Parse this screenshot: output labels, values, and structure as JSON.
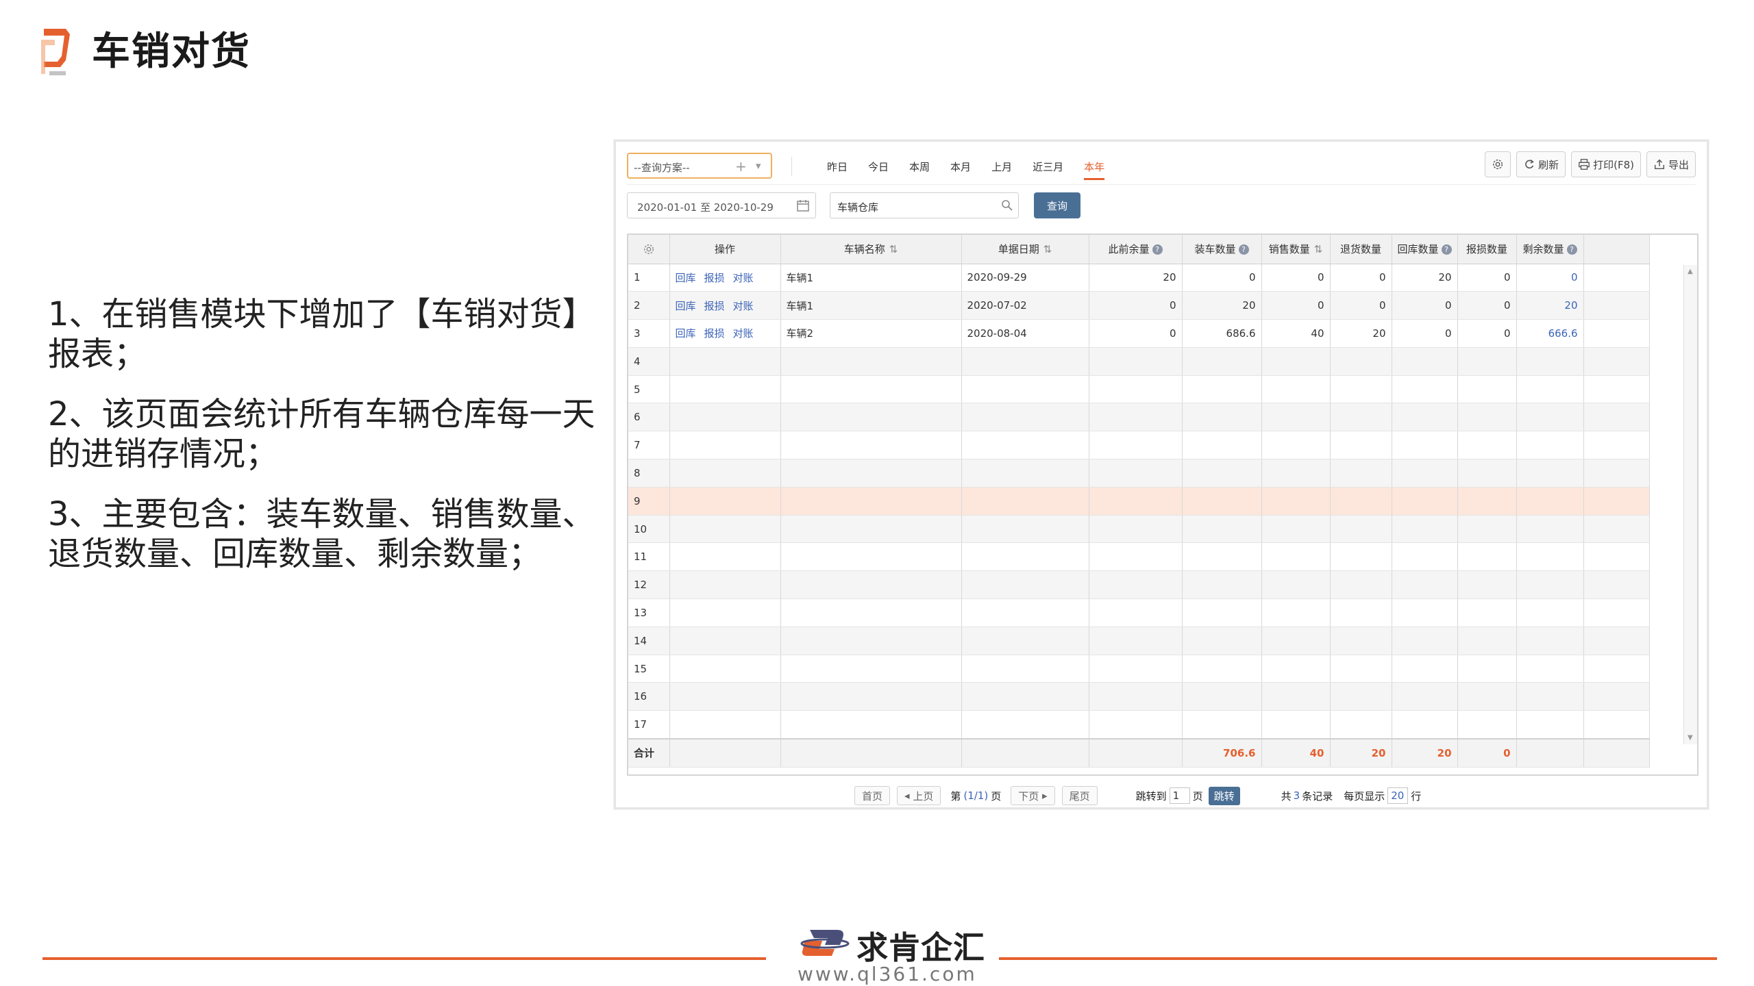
{
  "slide": {
    "title": "车销对货",
    "bullets": [
      "1、在销售模块下增加了【车销对货】报表；",
      "2、该页面会统计所有车辆仓库每一天的进销存情况；",
      "3、主要包含：装车数量、销售数量、退货数量、回库数量、剩余数量；"
    ]
  },
  "toolbar": {
    "scheme_placeholder": "--查询方案--",
    "quick_ranges": [
      "昨日",
      "今日",
      "本周",
      "本月",
      "上月",
      "近三月",
      "本年"
    ],
    "active_range": "本年",
    "refresh_label": "刷新",
    "print_label": "打印(F8)",
    "export_label": "导出"
  },
  "filters": {
    "date_range": "2020-01-01  至  2020-10-29",
    "warehouse": "车辆仓库",
    "query_label": "查询"
  },
  "grid": {
    "columns": [
      "操作",
      "车辆名称",
      "单据日期",
      "此前余量",
      "装车数量",
      "销售数量",
      "退货数量",
      "回库数量",
      "报损数量",
      "剩余数量"
    ],
    "row_actions": [
      "回库",
      "报损",
      "对账"
    ],
    "rows": [
      {
        "no": "1",
        "vehicle": "车辆1",
        "date": "2020-09-29",
        "prev": "20",
        "load": "0",
        "sale": "0",
        "return": "0",
        "back": "20",
        "loss": "0",
        "remain": "0"
      },
      {
        "no": "2",
        "vehicle": "车辆1",
        "date": "2020-07-02",
        "prev": "0",
        "load": "20",
        "sale": "0",
        "return": "0",
        "back": "0",
        "loss": "0",
        "remain": "20"
      },
      {
        "no": "3",
        "vehicle": "车辆2",
        "date": "2020-08-04",
        "prev": "0",
        "load": "686.6",
        "sale": "40",
        "return": "20",
        "back": "0",
        "loss": "0",
        "remain": "666.6"
      }
    ],
    "empty_row_numbers": [
      "4",
      "5",
      "6",
      "7",
      "8",
      "9",
      "10",
      "11",
      "12",
      "13",
      "14",
      "15",
      "16",
      "17"
    ],
    "highlight_row": "9",
    "totals_label": "合计",
    "totals": {
      "load": "706.6",
      "sale": "40",
      "return": "20",
      "back": "20",
      "loss": "0"
    }
  },
  "pager": {
    "first": "首页",
    "prev": "上页",
    "page_prefix": "第",
    "page_info": "(1/1)",
    "page_suffix": "页",
    "next": "下页",
    "last": "尾页",
    "jump_prefix": "跳转到",
    "jump_value": "1",
    "jump_suffix": "页",
    "jump_button": "跳转",
    "total_prefix": "共",
    "total_count": "3",
    "total_suffix": "条记录",
    "page_size_prefix": "每页显示",
    "page_size": "20",
    "page_size_suffix": "行"
  },
  "footer": {
    "brand_name": "求肯企汇",
    "url": "www.ql361.com"
  },
  "colors": {
    "accent": "#e5602f",
    "link": "#3b63b8",
    "button": "#4a6f95",
    "highlight_row": "#fde6dc"
  }
}
